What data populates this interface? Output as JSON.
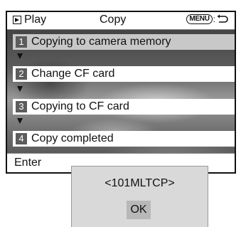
{
  "header": {
    "mode_icon": "play-icon",
    "mode_label": "Play",
    "title": "Copy",
    "menu_badge": "MENU",
    "menu_separator": ":",
    "back_icon": "back-arrow-icon"
  },
  "steps": [
    {
      "number": "1",
      "label": "Copying to camera memory",
      "active": true
    },
    {
      "number": "2",
      "label": "Change CF card",
      "active": false
    },
    {
      "number": "3",
      "label": "Copying to CF card",
      "active": false
    },
    {
      "number": "4",
      "label": "Copy completed",
      "active": false
    }
  ],
  "footer": {
    "label": "Enter"
  },
  "dialog": {
    "folder_name": "<101MLTCP>",
    "ok_label": "OK"
  },
  "colors": {
    "active_step": "#c8c8c8",
    "step_number_bg": "#5c5c5c",
    "dialog_bg": "#d9d9d9",
    "ok_button_bg": "#b8b8b8"
  }
}
